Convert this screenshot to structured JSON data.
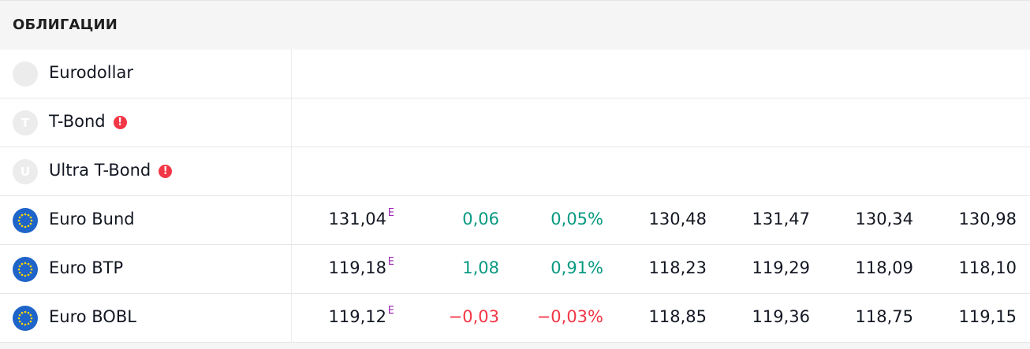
{
  "section": {
    "title": "ОБЛИГАЦИИ"
  },
  "colors": {
    "positive": "#089981",
    "negative": "#f23645",
    "delayed_badge": "#9c27b0",
    "eu_flag": "#1f64c8"
  },
  "rows": [
    {
      "name": "Eurodollar",
      "icon": "placeholder-circle-icon",
      "warning": false
    },
    {
      "name": "T-Bond",
      "icon": "letter-t-icon",
      "icon_letter": "T",
      "warning": true,
      "warning_glyph": "!"
    },
    {
      "name": "Ultra T-Bond",
      "icon": "letter-u-icon",
      "icon_letter": "U",
      "warning": true,
      "warning_glyph": "!"
    },
    {
      "name": "Euro Bund",
      "icon": "eu-flag-icon",
      "last": "131,04",
      "badge": "E",
      "chg": "0,06",
      "chgp": "0,05%",
      "open": "130,48",
      "high": "131,47",
      "low": "130,34",
      "close": "130,98",
      "direction": "up"
    },
    {
      "name": "Euro BTP",
      "icon": "eu-flag-icon",
      "last": "119,18",
      "badge": "E",
      "chg": "1,08",
      "chgp": "0,91%",
      "open": "118,23",
      "high": "119,29",
      "low": "118,09",
      "close": "118,10",
      "direction": "up"
    },
    {
      "name": "Euro BOBL",
      "icon": "eu-flag-icon",
      "last": "119,12",
      "badge": "E",
      "chg": "−0,03",
      "chgp": "−0,03%",
      "open": "118,85",
      "high": "119,36",
      "low": "118,75",
      "close": "119,15",
      "direction": "down"
    }
  ]
}
